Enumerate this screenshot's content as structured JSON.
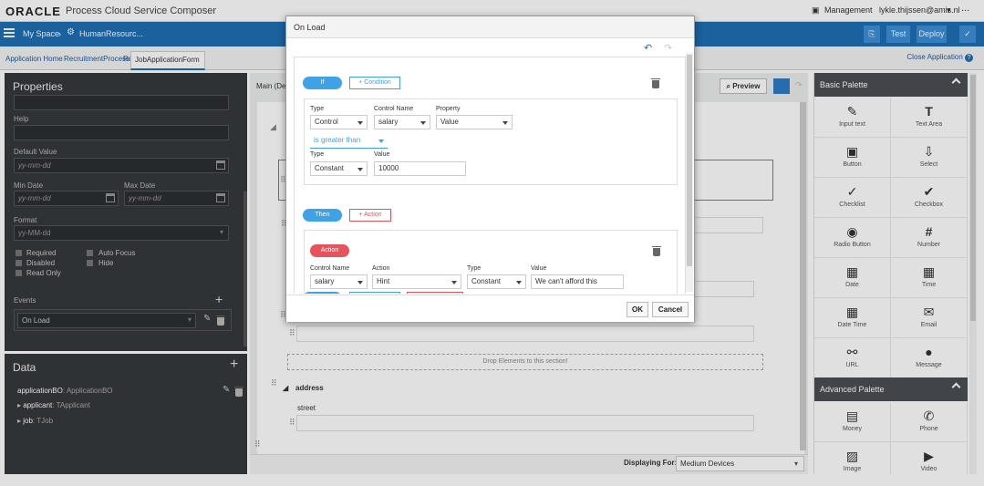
{
  "header": {
    "logo": "ORACLE",
    "app_title": "Process Cloud Service Composer",
    "management": "Management",
    "user": "lykle.thijssen@amis.nl",
    "more": "..."
  },
  "nav": {
    "my_space": "My Space",
    "project": "HumanResourc...",
    "test": "Test",
    "deploy": "Deploy"
  },
  "tabs": [
    {
      "label": "Application Home"
    },
    {
      "label": "RecruitmentProcess"
    },
    {
      "label": "JobApplicationForm"
    }
  ],
  "close_application": "Close Application",
  "properties": {
    "title": "Properties",
    "help_label": "Help",
    "default_value_label": "Default Value",
    "default_value_placeholder": "yy-mm-dd",
    "min_date_label": "Min Date",
    "min_date_placeholder": "yy-mm-dd",
    "max_date_label": "Max Date",
    "max_date_placeholder": "yy-mm-dd",
    "format_label": "Format",
    "format_value": "yy-MM-dd",
    "checkboxes": [
      "Required",
      "Auto Focus",
      "Disabled",
      "Hide",
      "Read Only"
    ],
    "events_label": "Events",
    "event_value": "On Load"
  },
  "data_panel": {
    "title": "Data",
    "items": [
      {
        "name": "applicationBO",
        "type": ": ApplicationBO"
      },
      {
        "name": "applicant",
        "type": ": TApplicant"
      },
      {
        "name": "job",
        "type": ": TJob"
      }
    ]
  },
  "canvas": {
    "main_label": "Main (De",
    "preview": "Preview",
    "drop_hint": "Drop Elements to this section!",
    "section_address": "address",
    "field_street": "street",
    "displaying_for_label": "Displaying For:",
    "displaying_for_value": "Medium Devices"
  },
  "palette": {
    "basic_title": "Basic Palette",
    "advanced_title": "Advanced Palette",
    "basic_items": [
      {
        "label": "Input text",
        "icon": "pencil-icon"
      },
      {
        "label": "Text Area",
        "icon": "text-area-icon"
      },
      {
        "label": "Button",
        "icon": "button-icon"
      },
      {
        "label": "Select",
        "icon": "select-icon"
      },
      {
        "label": "Checklist",
        "icon": "checklist-icon"
      },
      {
        "label": "Checkbox",
        "icon": "checkbox-icon"
      },
      {
        "label": "Radio Button",
        "icon": "radio-icon"
      },
      {
        "label": "Number",
        "icon": "number-icon"
      },
      {
        "label": "Date",
        "icon": "date-icon"
      },
      {
        "label": "Time",
        "icon": "time-icon"
      },
      {
        "label": "Date Time",
        "icon": "datetime-icon"
      },
      {
        "label": "Email",
        "icon": "email-icon"
      },
      {
        "label": "URL",
        "icon": "url-icon"
      },
      {
        "label": "Message",
        "icon": "message-icon"
      }
    ],
    "advanced_items": [
      {
        "label": "Money",
        "icon": "money-icon"
      },
      {
        "label": "Phone",
        "icon": "phone-icon"
      },
      {
        "label": "Image",
        "icon": "image-icon"
      },
      {
        "label": "Video",
        "icon": "video-icon"
      }
    ]
  },
  "modal": {
    "title": "On Load",
    "if_label": "If",
    "add_condition": "+ Condition",
    "type_label": "Type",
    "control_name_label": "Control Name",
    "property_label": "Property",
    "type_value": "Control",
    "control_name_value": "salary",
    "property_value": "Value",
    "operator_value": "is greater than",
    "type2_label": "Type",
    "value_label": "Value",
    "type2_value": "Constant",
    "value_value": "10000",
    "then_label": "Then",
    "add_action": "+ Action",
    "action_label": "Action",
    "a_control_name_label": "Control Name",
    "a_action_label": "Action",
    "a_type_label": "Type",
    "a_value_label": "Value",
    "a_control_name_value": "salary",
    "a_action_value": "Hint",
    "a_type_value": "Constant",
    "a_value_value": "We can't afford this",
    "ok": "OK",
    "cancel": "Cancel"
  },
  "colors": {
    "brand_blue": "#1f6fb3",
    "pill_blue": "#3fa2e6",
    "pill_red": "#e8525c",
    "dark_panel": "#36393d"
  }
}
